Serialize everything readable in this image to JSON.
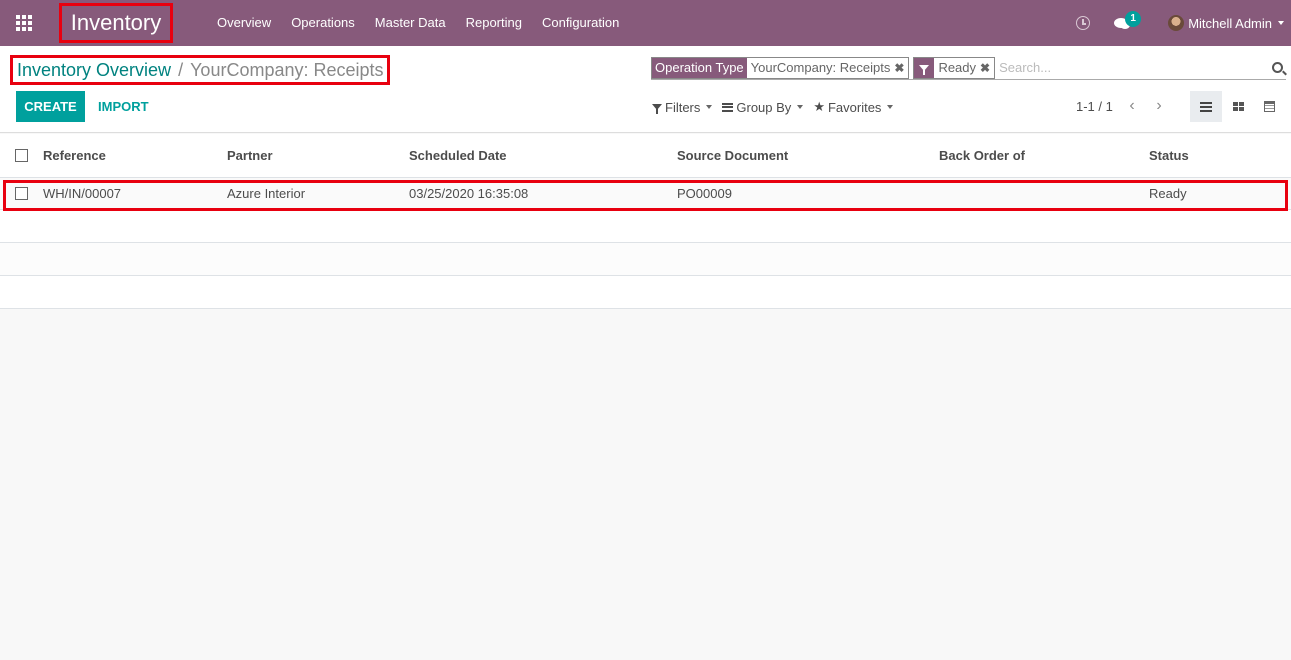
{
  "navbar": {
    "app_name": "Inventory",
    "menu": [
      "Overview",
      "Operations",
      "Master Data",
      "Reporting",
      "Configuration"
    ],
    "icons": {
      "apps": "apps-grid-icon",
      "activity": "clock-icon",
      "messages": "chat-icon"
    },
    "message_count": "1",
    "user_name": "Mitchell Admin"
  },
  "breadcrumb": {
    "parent": "Inventory Overview",
    "separator": "/",
    "current": "YourCompany: Receipts"
  },
  "search": {
    "facets": [
      {
        "label": "Operation Type",
        "value": "YourCompany: Receipts",
        "remove": "✖"
      },
      {
        "label_icon": "filter-icon",
        "value": "Ready",
        "remove": "✖"
      }
    ],
    "placeholder": "Search..."
  },
  "buttons": {
    "create": "CREATE",
    "import": "IMPORT"
  },
  "search_options": {
    "filters": "Filters",
    "group_by": "Group By",
    "favorites": "Favorites"
  },
  "pager": {
    "value": "1-1 / 1",
    "prev": "‹",
    "next": "›"
  },
  "views": [
    "list",
    "kanban",
    "calendar"
  ],
  "active_view": "list",
  "table": {
    "columns": [
      "Reference",
      "Partner",
      "Scheduled Date",
      "Source Document",
      "Back Order of",
      "Status"
    ],
    "rows": [
      {
        "reference": "WH/IN/00007",
        "partner": "Azure Interior",
        "scheduled_date": "03/25/2020 16:35:08",
        "source_document": "PO00009",
        "back_order_of": "",
        "status": "Ready"
      }
    ]
  },
  "colors": {
    "brand": "#875a7b",
    "accent": "#00a09d",
    "highlight": "#e8000f"
  }
}
